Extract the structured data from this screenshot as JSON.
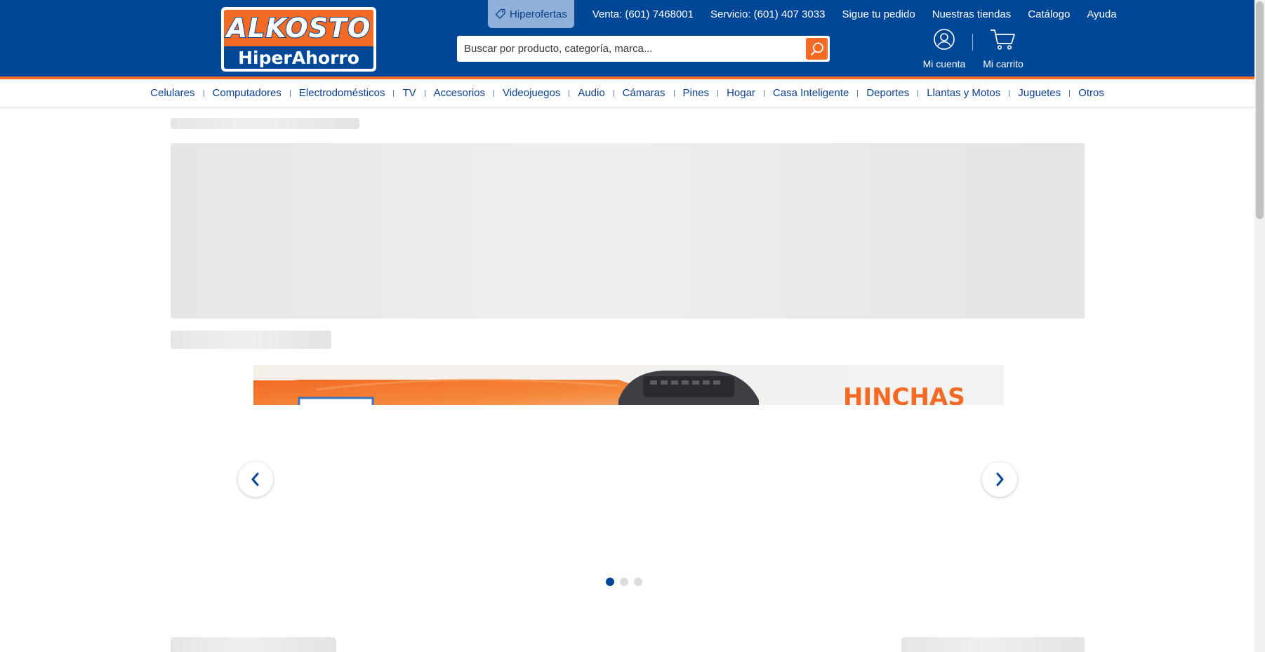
{
  "brand": {
    "logo_top": "ALKOSTO",
    "logo_bottom": "HiperAhorro"
  },
  "topnav": {
    "hiperofertas": "Hiperofertas",
    "links": [
      "Venta: (601) 7468001",
      "Servicio: (601) 407 3033",
      "Sigue tu pedido",
      "Nuestras tiendas",
      "Catálogo",
      "Ayuda"
    ]
  },
  "search": {
    "placeholder": "Buscar por producto, categoría, marca..."
  },
  "account": {
    "label": "Mi cuenta"
  },
  "cart": {
    "label": "Mi carrito"
  },
  "categories": [
    "Celulares",
    "Computadores",
    "Electrodomésticos",
    "TV",
    "Accesorios",
    "Videojuegos",
    "Audio",
    "Cámaras",
    "Pines",
    "Hogar",
    "Casa Inteligente",
    "Deportes",
    "Llantas y Motos",
    "Juguetes",
    "Otros"
  ],
  "banner": {
    "headline": "HINCHAS",
    "slides": 3,
    "active_slide": 1
  },
  "colors": {
    "brand_blue": "#004797",
    "brand_orange": "#f26a24",
    "hiper_bg": "#8fb0d8"
  },
  "icons": {
    "hiperofertas": "tag-icon",
    "search": "search-icon",
    "account": "user-circle-icon",
    "cart": "cart-icon",
    "prev": "chevron-left-icon",
    "next": "chevron-right-icon"
  }
}
